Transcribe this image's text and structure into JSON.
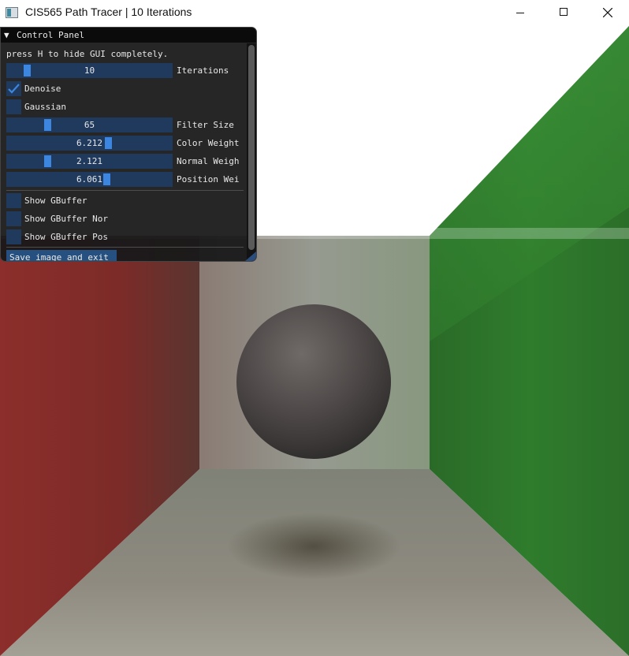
{
  "window": {
    "title": "CIS565 Path Tracer | 10 Iterations",
    "icons": {
      "app": "app-icon",
      "minimize": "minimize-icon",
      "maximize": "maximize-icon",
      "close": "close-icon"
    }
  },
  "panel": {
    "title": "Control Panel",
    "collapse_icon": "triangle-down-icon",
    "hint": "press H to hide GUI completely.",
    "sliders": [
      {
        "label": "Iterations",
        "value": "10",
        "position": 0.1
      },
      {
        "label": "Filter Size",
        "value": "65",
        "position": 0.23
      },
      {
        "label": "Color Weight",
        "value": "6.212",
        "position": 0.62
      },
      {
        "label": "Normal Weigh",
        "value": "2.121",
        "position": 0.23
      },
      {
        "label": "Position Wei",
        "value": "6.061",
        "position": 0.61
      }
    ],
    "checkboxes": [
      {
        "label": "Denoise",
        "checked": true
      },
      {
        "label": "Gaussian",
        "checked": false
      },
      {
        "label": "Show GBuffer",
        "checked": false
      },
      {
        "label": "Show GBuffer Nor",
        "checked": false
      },
      {
        "label": "Show GBuffer Pos",
        "checked": false
      }
    ],
    "save_button": "Save image and exit"
  },
  "colors": {
    "accent": "#3d86e0",
    "frame_bg": "#203a5e",
    "panel_bg": "#18181a",
    "left_wall": "#8a2e2a",
    "right_wall": "#2f7a2c",
    "back_wall": "#8f9c88"
  }
}
